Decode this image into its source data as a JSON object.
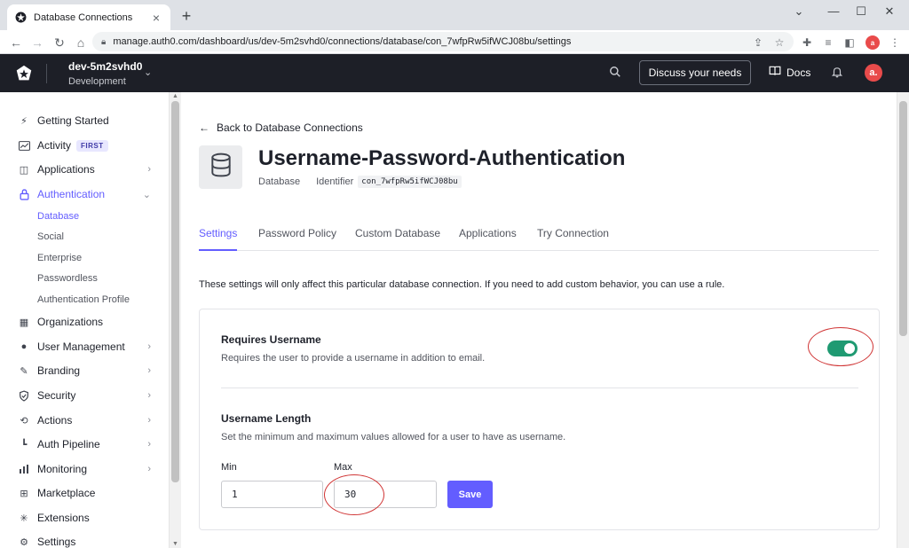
{
  "browser": {
    "tab_title": "Database Connections",
    "url": "manage.auth0.com/dashboard/us/dev-5m2svhd0/connections/database/con_7wfpRw5ifWCJ08bu/settings"
  },
  "appbar": {
    "tenant_name": "dev-5m2svhd0",
    "tenant_env": "Development",
    "discuss_label": "Discuss your needs",
    "docs_label": "Docs",
    "avatar_letter": "a."
  },
  "sidebar": {
    "items": [
      {
        "label": "Getting Started",
        "icon": "bolt-icon"
      },
      {
        "label": "Activity",
        "icon": "activity-icon",
        "badge": "FIRST"
      },
      {
        "label": "Applications",
        "icon": "layers-icon"
      },
      {
        "label": "Authentication",
        "icon": "lock-icon"
      },
      {
        "label": "Organizations",
        "icon": "building-icon"
      },
      {
        "label": "User Management",
        "icon": "users-icon"
      },
      {
        "label": "Branding",
        "icon": "brush-icon"
      },
      {
        "label": "Security",
        "icon": "shield-icon"
      },
      {
        "label": "Actions",
        "icon": "actions-icon"
      },
      {
        "label": "Auth Pipeline",
        "icon": "pipeline-icon"
      },
      {
        "label": "Monitoring",
        "icon": "chart-icon"
      },
      {
        "label": "Marketplace",
        "icon": "marketplace-icon"
      },
      {
        "label": "Extensions",
        "icon": "extensions-icon"
      },
      {
        "label": "Settings",
        "icon": "gear-icon"
      }
    ],
    "auth_sub": [
      "Database",
      "Social",
      "Enterprise",
      "Passwordless",
      "Authentication Profile"
    ]
  },
  "main": {
    "back_label": "Back to Database Connections",
    "title": "Username-Password-Authentication",
    "type": "Database",
    "identifier_label": "Identifier",
    "identifier": "con_7wfpRw5ifWCJ08bu",
    "tabs": [
      "Settings",
      "Password Policy",
      "Custom Database",
      "Applications",
      "Try Connection"
    ],
    "description": "These settings will only affect this particular database connection. If you need to add custom behavior, you can use a rule.",
    "requires_username": {
      "title": "Requires Username",
      "desc": "Requires the user to provide a username in addition to email.",
      "enabled": true
    },
    "username_length": {
      "title": "Username Length",
      "desc": "Set the minimum and maximum values allowed for a user to have as username.",
      "min_label": "Min",
      "max_label": "Max",
      "min_value": "1",
      "max_value": "30",
      "save_label": "Save"
    }
  },
  "colors": {
    "accent": "#635dff",
    "toggle_on": "#1f9a72",
    "annotation": "#d03535",
    "appbar": "#1d1f27"
  }
}
